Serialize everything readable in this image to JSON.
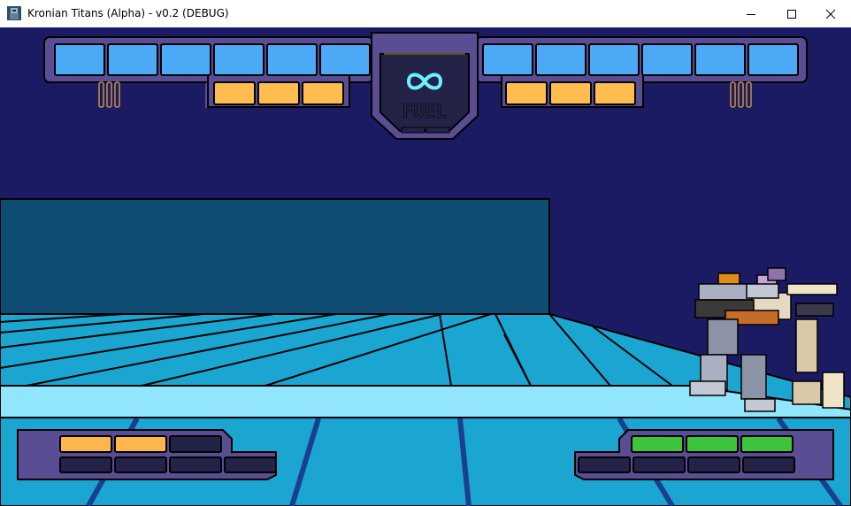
{
  "window": {
    "title": "Kronian Titans (Alpha) - v0.2 (DEBUG)",
    "controls": [
      "minimize",
      "maximize",
      "close"
    ]
  },
  "hud": {
    "fuel_label": "FUEL",
    "fuel_value_icon": "infinity-icon",
    "left_shield_segments": 6,
    "right_shield_segments": 6,
    "left_energy_segments": 3,
    "right_energy_segments": 3
  },
  "players": {
    "p1_ammo": {
      "filled": 2,
      "total": 3,
      "color": "#ffb74d"
    },
    "p1_health": {
      "filled": 0,
      "total": 4
    },
    "p2_ammo": {
      "filled": 3,
      "total": 3,
      "color": "#3cc43c"
    },
    "p2_health": {
      "filled": 0,
      "total": 4
    }
  },
  "colors": {
    "shield": "#4ba9f5",
    "energy": "#ffbd4f",
    "frame": "#5a4d94",
    "sky": "#1b1b64",
    "floor": "#1aa6d1",
    "wall": "#0e4c73",
    "fuel_icon": "#6cf0ff"
  }
}
